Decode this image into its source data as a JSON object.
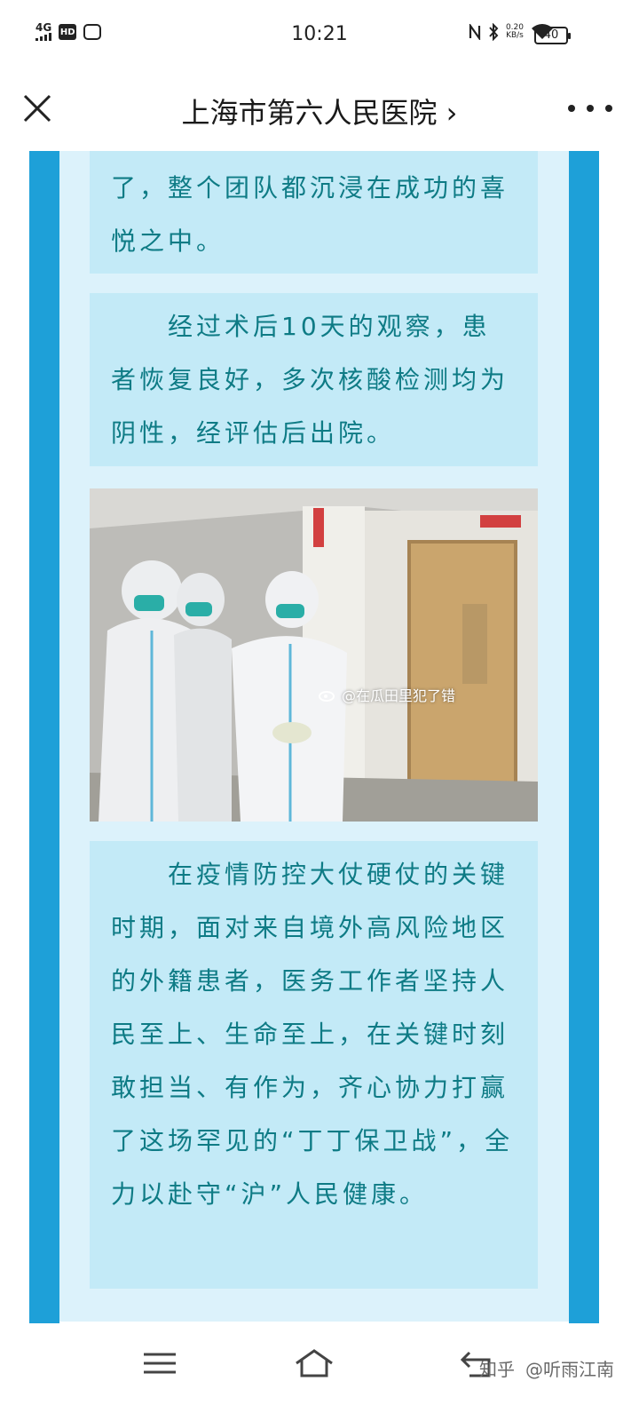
{
  "status_bar": {
    "network": "4G",
    "hd": "HD",
    "time": "10:21",
    "speed_value": "0.20",
    "speed_unit": "KB/s",
    "battery": "40"
  },
  "header": {
    "title": "上海市第六人民医院 ›"
  },
  "article": {
    "paragraph_1": "了，整个团队都沉浸在成功的喜悦之中。",
    "paragraph_2": "　　经过术后10天的观察，患者恢复良好，多次核酸检测均为阴性，经评估后出院。",
    "photo_watermark": "@在瓜田里犯了错",
    "paragraph_3": "　　在疫情防控大仗硬仗的关键时期，面对来自境外高风险地区的外籍患者，医务工作者坚持人民至上、生命至上，在关键时刻敢担当、有作为，齐心协力打赢了这场罕见的“丁丁保卫战”，全力以赴守“沪”人民健康。"
  },
  "footer": {
    "zhihu_watermark_1": "知乎",
    "zhihu_watermark_2": "@听雨江南"
  },
  "colors": {
    "frame": "#1ea0d8",
    "panel": "#c3eaf7",
    "text": "#0e7b85"
  }
}
